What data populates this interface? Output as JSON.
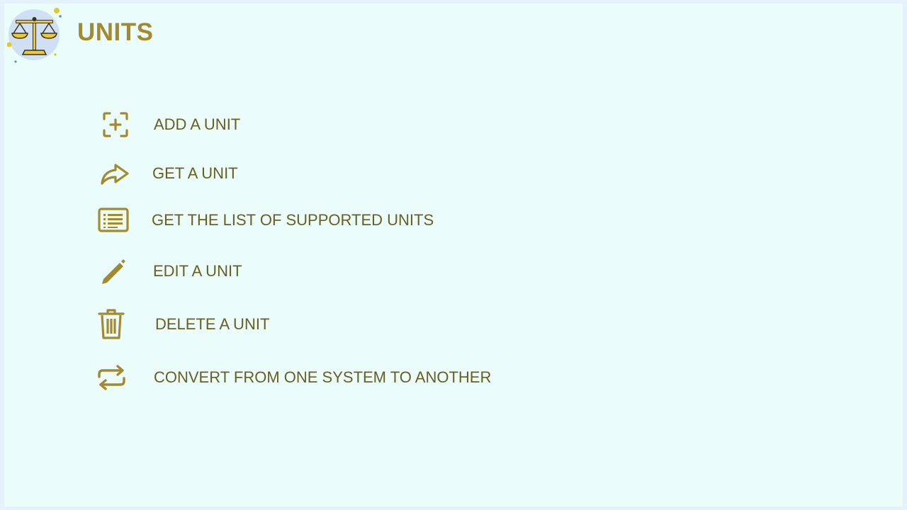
{
  "header": {
    "title": "UNITS",
    "logo_icon": "scale-balance-icon"
  },
  "colors": {
    "accent": "#a38a2e",
    "text": "#686022",
    "background": "#ebfdfb",
    "logo_circle": "#cfe0f4"
  },
  "menu": {
    "items": [
      {
        "icon": "add-square-icon",
        "label": "ADD A UNIT"
      },
      {
        "icon": "share-arrow-icon",
        "label": "GET A UNIT"
      },
      {
        "icon": "list-icon",
        "label": "GET THE LIST OF SUPPORTED UNITS"
      },
      {
        "icon": "pencil-icon",
        "label": "EDIT A UNIT"
      },
      {
        "icon": "trash-icon",
        "label": "DELETE A UNIT"
      },
      {
        "icon": "repeat-arrows-icon",
        "label": "CONVERT FROM ONE SYSTEM TO ANOTHER"
      }
    ]
  }
}
